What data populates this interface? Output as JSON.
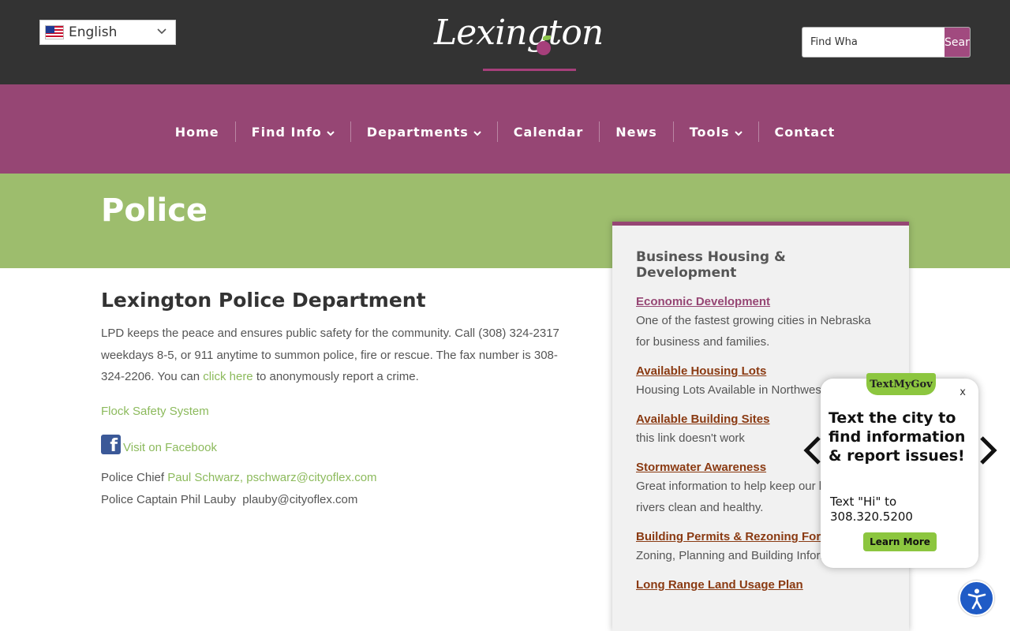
{
  "header": {
    "language": "English",
    "logo_text": "Lexington",
    "search_placeholder": "Find What You Need",
    "search_value": "Find Wha",
    "search_button": "Search"
  },
  "nav": {
    "items": [
      {
        "label": "Home"
      },
      {
        "label": "Find Info"
      },
      {
        "label": "Departments"
      },
      {
        "label": "Calendar"
      },
      {
        "label": "News"
      },
      {
        "label": "Tools"
      },
      {
        "label": "Contact"
      }
    ]
  },
  "page": {
    "title": "Police"
  },
  "main": {
    "heading": "Lexington Police Department",
    "intro_before": "LPD keeps the peace and ensures public safety for the community. Call (308) 324-2317 weekdays 8-5, or 911 anytime to summon police, fire or rescue. The fax number is 308-324-2206. You can ",
    "intro_link": "click here",
    "intro_after": " to anonymously report a crime.",
    "flock_link": "Flock Safety System",
    "facebook_link": "Visit on Facebook",
    "chief_prefix": "Police Chief ",
    "chief_link": "Paul Schwarz, pschwarz@cityoflex.com",
    "captain": "Police Captain Phil Lauby  plauby@cityoflex.com"
  },
  "sidebar": {
    "heading": "Business Housing & Development",
    "items": [
      {
        "title": "Economic Development",
        "desc": "One of the fastest growing cities in Nebraska for business and families.",
        "color": "#964674"
      },
      {
        "title": "Available Housing Lots",
        "desc": "Housing Lots Available in Northwest Lexington",
        "color": "#8a3a12"
      },
      {
        "title": "Available Building Sites",
        "desc": "this link doesn't work",
        "color": "#8a3a12"
      },
      {
        "title": "Stormwater Awareness",
        "desc": "Great information to help keep our lakes and rivers clean and healthy.",
        "color": "#8a3a12"
      },
      {
        "title": "Building Permits & Rezoning Forms",
        "desc": "Zoning, Planning and Building Information",
        "color": "#8a3a12"
      },
      {
        "title": "Long Range Land Usage Plan",
        "desc": "",
        "color": "#8a3a12"
      }
    ]
  },
  "popup": {
    "badge": "TextMyGov",
    "close": "x",
    "headline": "Text the city to find information & report issues!",
    "body": "Text \"Hi\" to 308.320.5200",
    "button": "Learn More"
  },
  "colors": {
    "header_bg": "#333333",
    "nav_bg": "#964674",
    "title_band": "#9dbd6d",
    "link_green": "#8cba5c",
    "accent_green": "#8cc63f"
  }
}
